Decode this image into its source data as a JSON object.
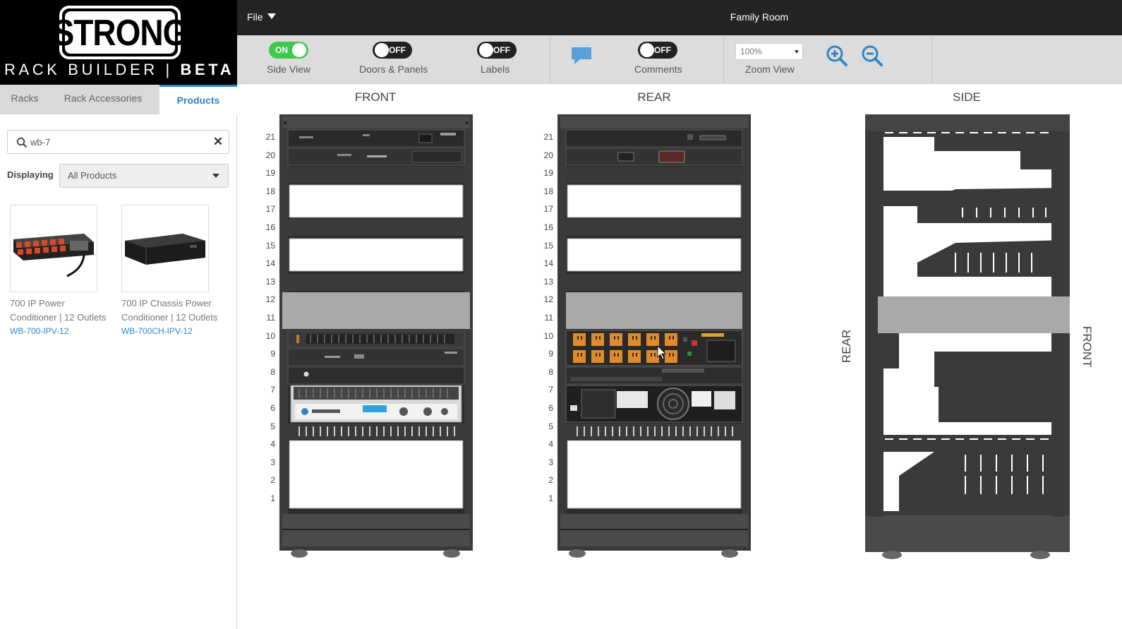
{
  "brand": {
    "logo": "STRONG",
    "tagline_light": "RACK BUILDER | ",
    "tagline_bold": "BETA"
  },
  "sidebar": {
    "tabs": [
      {
        "label": "Racks",
        "active": false
      },
      {
        "label": "Rack Accessories",
        "active": false
      },
      {
        "label": "Products",
        "active": true
      }
    ],
    "search": {
      "value": "wb-7",
      "placeholder": ""
    },
    "displaying": {
      "label": "Displaying",
      "value": "All Products"
    },
    "products": [
      {
        "name": "700 IP Power Conditioner | 12 Outlets",
        "sku": "WB-700-IPV-12",
        "icon": "power-conditioner-image"
      },
      {
        "name": "700 IP Chassis Power Conditioner | 12 Outlets",
        "sku": "WB-700CH-IPV-12",
        "icon": "chassis-power-conditioner-image"
      }
    ]
  },
  "topbar": {
    "file_label": "File",
    "room_title": "Family Room"
  },
  "toolbar": {
    "side_view": {
      "label": "Side View",
      "state": "ON",
      "on": true
    },
    "doors_panels": {
      "label": "Doors & Panels",
      "state": "OFF",
      "on": false
    },
    "labels": {
      "label": "Labels",
      "state": "OFF",
      "on": false
    },
    "comments": {
      "label": "Comments",
      "state": "OFF",
      "on": false,
      "icon": "comment-icon"
    },
    "zoom": {
      "label": "Zoom View",
      "value": "100%",
      "zoom_in_icon": "zoom-in-icon",
      "zoom_out_icon": "zoom-out-icon"
    }
  },
  "views": {
    "front_title": "FRONT",
    "rear_title": "REAR",
    "side_title": "SIDE",
    "side_rear_label": "REAR",
    "side_front_label": "FRONT"
  },
  "rack_units": [
    "21",
    "20",
    "19",
    "18",
    "17",
    "16",
    "15",
    "14",
    "13",
    "12",
    "11",
    "10",
    "9",
    "8",
    "7",
    "6",
    "5",
    "4",
    "3",
    "2",
    "1"
  ],
  "colors": {
    "accent": "#2e86c8",
    "toggle_on": "#3ec94e",
    "toggle_off": "#222222",
    "rack": "#3a3a3a",
    "outlet": "#e08a2a"
  }
}
